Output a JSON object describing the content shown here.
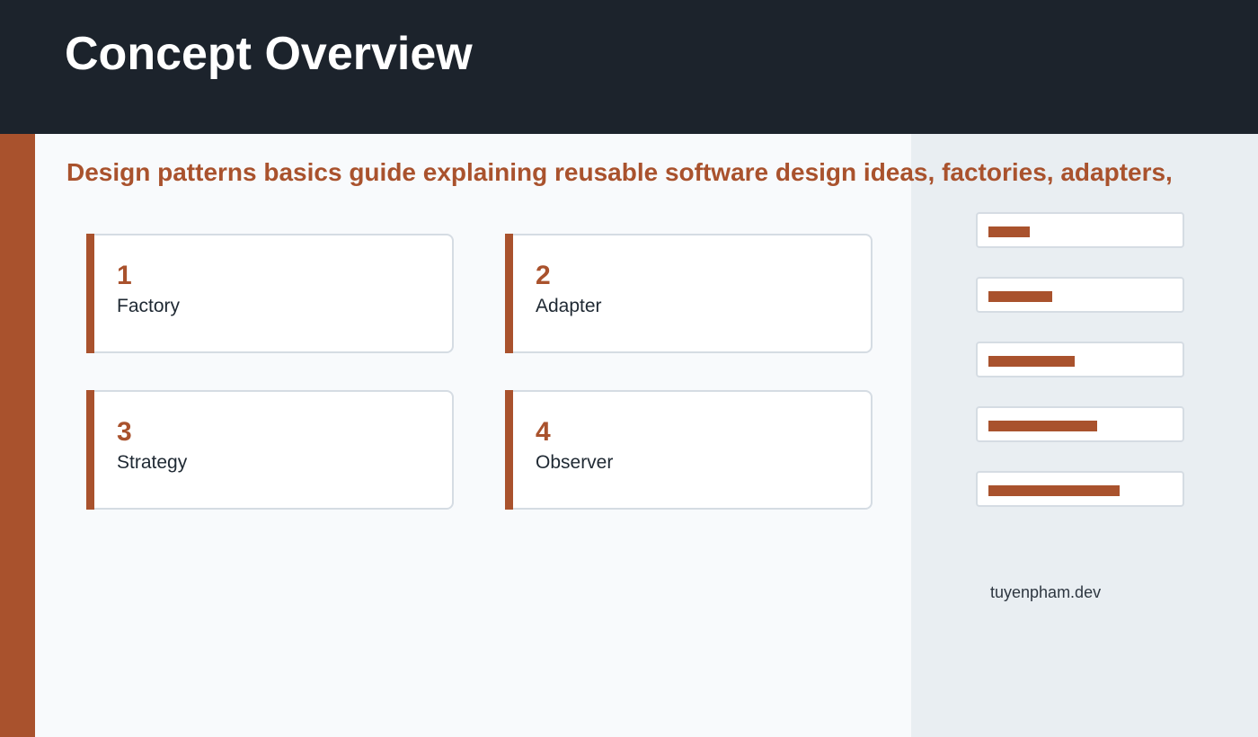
{
  "header": {
    "title": "Concept Overview"
  },
  "subtitle": "Design patterns basics guide explaining reusable software design ideas, factories, adapters,",
  "cards": [
    {
      "number": "1",
      "label": "Factory"
    },
    {
      "number": "2",
      "label": "Adapter"
    },
    {
      "number": "3",
      "label": "Strategy"
    },
    {
      "number": "4",
      "label": "Observer"
    }
  ],
  "progress_bars": [
    {
      "fill_fraction": 0.22
    },
    {
      "fill_fraction": 0.34
    },
    {
      "fill_fraction": 0.46
    },
    {
      "fill_fraction": 0.58
    },
    {
      "fill_fraction": 0.7
    }
  ],
  "footer": {
    "credit": "tuyenpham.dev"
  },
  "colors": {
    "accent": "#a9522d",
    "header_bg": "#1c232c",
    "main_bg": "#f8fafc",
    "side_bg": "#e9eef2"
  }
}
